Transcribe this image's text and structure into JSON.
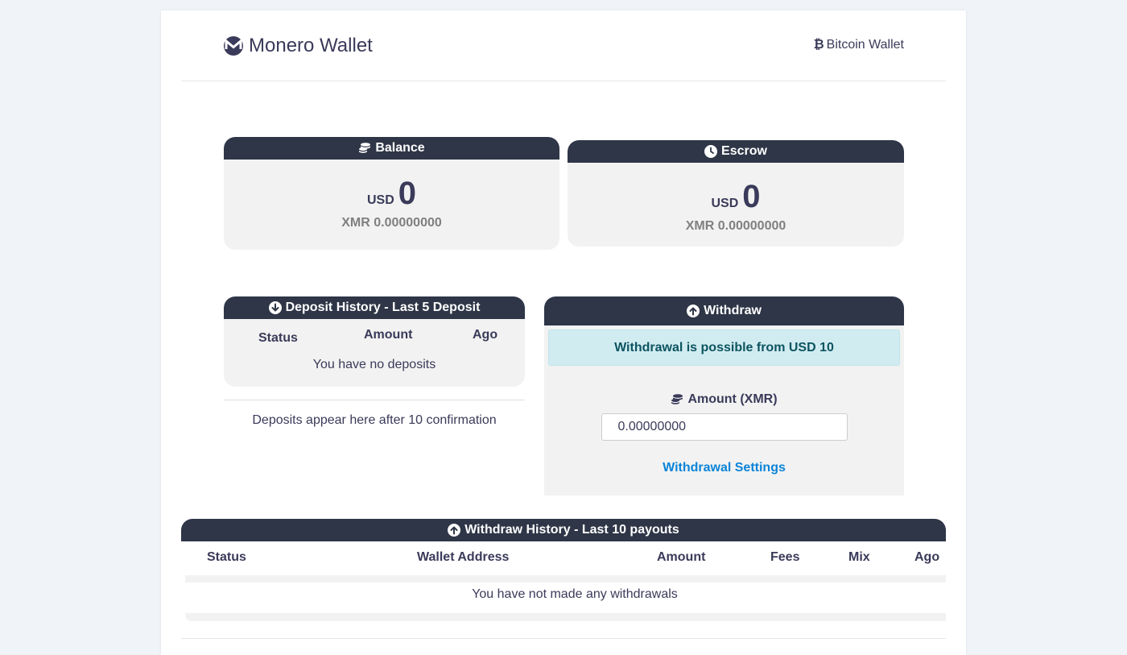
{
  "header": {
    "brand_title": "Monero Wallet",
    "brand_icon": "monero-logo",
    "bitcoin_link_label": "Bitcoin Wallet",
    "bitcoin_icon": "bitcoin-icon"
  },
  "balance": {
    "title": "Balance",
    "currency": "USD",
    "value": "0",
    "xmr": "XMR 0.00000000"
  },
  "escrow": {
    "title": "Escrow",
    "currency": "USD",
    "value": "0",
    "xmr": "XMR 0.00000000"
  },
  "deposit_history": {
    "title": "Deposit History - Last 5 Deposit",
    "columns": [
      "Status",
      "Amount",
      "Ago"
    ],
    "empty_message": "You have no deposits",
    "note": "Deposits appear here after 10 confirmation"
  },
  "withdraw": {
    "title": "Withdraw",
    "alert": "Withdrawal is possible from USD 10",
    "amount_label": "Amount (XMR)",
    "amount_value": "0.00000000",
    "settings_link": "Withdrawal Settings"
  },
  "withdraw_history": {
    "title": "Withdraw History - Last 10 payouts",
    "columns": [
      "Status",
      "Wallet Address",
      "Amount",
      "Fees",
      "Mix",
      "Ago"
    ],
    "empty_message": "You have not made any withdrawals"
  },
  "colors": {
    "page_bg": "#f0f3f7",
    "panel_header": "#2e3647",
    "panel_body": "#f2f2f2",
    "alert_bg": "#d1ecf1",
    "alert_text": "#0c5460",
    "link": "#0b84d8"
  }
}
